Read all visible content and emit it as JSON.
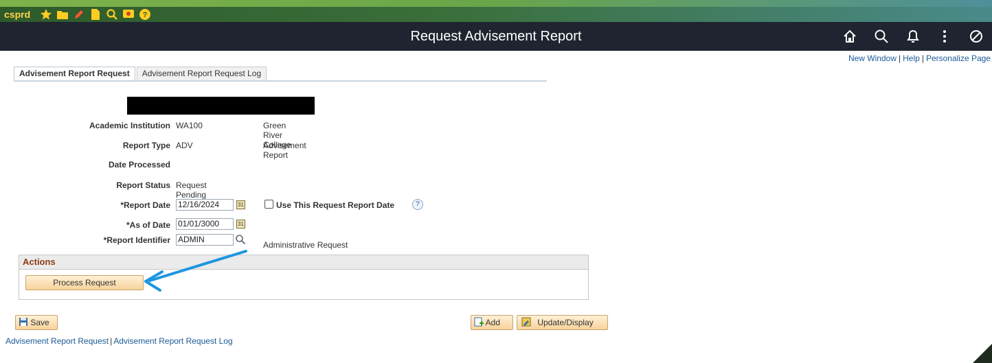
{
  "env": {
    "name": "csprd"
  },
  "header": {
    "title": "Request Advisement Report",
    "icons": [
      "home-icon",
      "search-icon",
      "bell-icon",
      "more-icon",
      "navbar-icon"
    ]
  },
  "toplinks": {
    "new_window": "New Window",
    "help": "Help",
    "personalize": "Personalize Page"
  },
  "tabs": [
    {
      "label": "Advisement Report Request",
      "active": true
    },
    {
      "label": "Advisement Report Request Log",
      "active": false
    }
  ],
  "form": {
    "institution": {
      "label": "Academic Institution",
      "value": "WA100",
      "desc": "Green River College"
    },
    "report_type": {
      "label": "Report Type",
      "value": "ADV",
      "desc": "Advisement Report"
    },
    "date_processed": {
      "label": "Date Processed",
      "value": ""
    },
    "report_status": {
      "label": "Report Status",
      "value": "Request Pending"
    },
    "report_date": {
      "label": "*Report Date",
      "value": "12/16/2024"
    },
    "use_request_date": {
      "label": "Use This Request Report Date",
      "checked": false
    },
    "as_of_date": {
      "label": "*As of Date",
      "value": "01/01/3000"
    },
    "report_identifier": {
      "label": "*Report Identifier",
      "value": "ADMIN",
      "desc": "Administrative Request"
    }
  },
  "actions": {
    "title": "Actions",
    "process_button": "Process Request"
  },
  "toolbar": {
    "save": "Save",
    "add": "Add",
    "update_display": "Update/Display"
  },
  "bottomlinks": {
    "request": "Advisement Report Request",
    "log": "Advisement Report Request Log"
  },
  "colors": {
    "header_bg": "#1f2430",
    "link": "#1a5a96",
    "section_title": "#8a3b16",
    "arrow": "#1e96e0"
  }
}
